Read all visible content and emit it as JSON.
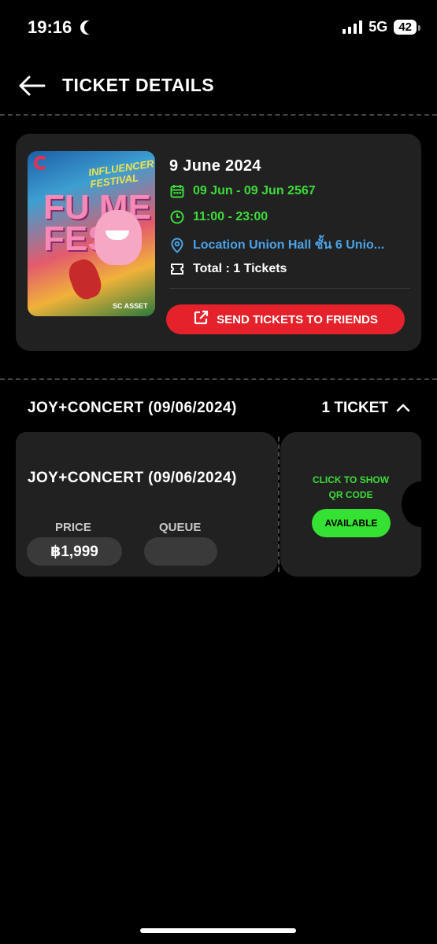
{
  "status_bar": {
    "time": "19:16",
    "network": "5G",
    "battery": "42"
  },
  "header": {
    "title": "TICKET DETAILS",
    "back_icon": "arrow-left-icon"
  },
  "event": {
    "date_heading": "9 June 2024",
    "date_range": "09 Jun - 09 Jun 2567",
    "time_range": "11:00 - 23:00",
    "location": "Location Union Hall  ชั้น 6 Unio...",
    "total": "Total : 1 Tickets",
    "send_button": "SEND TICKETS TO FRIENDS",
    "poster": {
      "title": "INFLUENCER FESTIVAL",
      "big_text": "FU ME FEST",
      "footer": "SC ASSET"
    }
  },
  "ticket_section": {
    "title": "JOY+CONCERT (09/06/2024)",
    "count": "1 TICKET",
    "tickets": [
      {
        "name": "JOY+CONCERT (09/06/2024)",
        "price_label": "PRICE",
        "price_value": "฿1,999",
        "queue_label": "QUEUE",
        "queue_value": "",
        "qr_text_line1": "CLICK TO SHOW",
        "qr_text_line2": "QR CODE",
        "status": "AVAILABLE"
      }
    ]
  },
  "colors": {
    "accent_green": "#3ddc3a",
    "accent_red": "#e5222b",
    "link_blue": "#4ba3e8",
    "card_bg": "#212121"
  }
}
